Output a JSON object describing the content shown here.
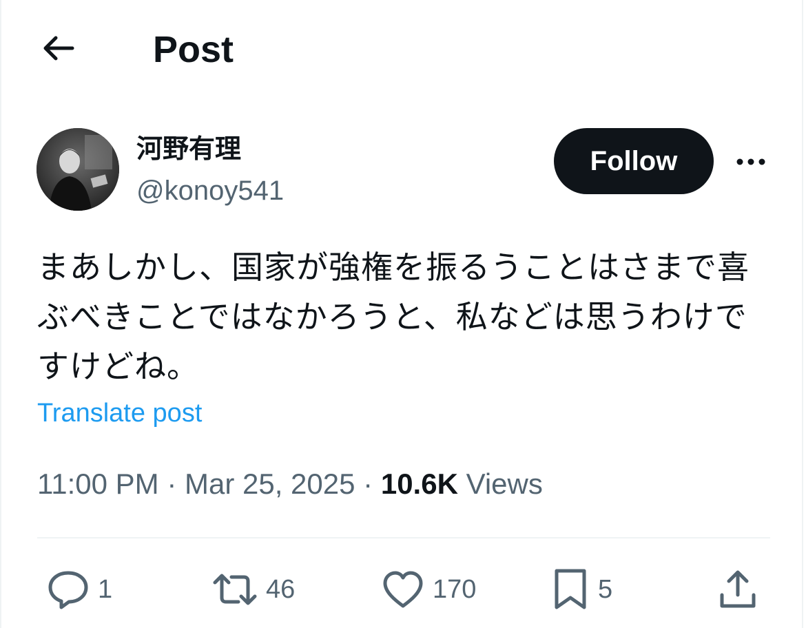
{
  "header": {
    "title": "Post",
    "back_icon": "arrow-left-icon"
  },
  "author": {
    "display_name": "河野有理",
    "handle": "@konoy541"
  },
  "follow_label": "Follow",
  "post": {
    "text": "まあしかし、国家が強権を振るうことはさまで喜\nぶべきことではなかろうと、私などは思うわけで\nすけどね。",
    "translate_label": "Translate post"
  },
  "meta": {
    "time": "11:00 PM",
    "separator": "·",
    "date": "Mar 25, 2025",
    "views_count": "10.6K",
    "views_label": "Views"
  },
  "actions": {
    "replies": "1",
    "reposts": "46",
    "likes": "170",
    "bookmarks": "5"
  },
  "colors": {
    "text_primary": "#0f1419",
    "text_secondary": "#536471",
    "link": "#1d9bf0",
    "divider": "#eff3f4"
  }
}
